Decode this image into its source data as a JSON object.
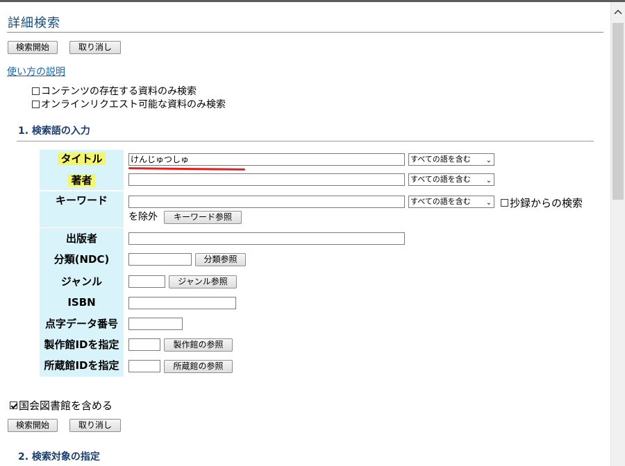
{
  "page_title": "詳細検索",
  "buttons": {
    "search": "検索開始",
    "cancel": "取り消し"
  },
  "help_link": "使い方の説明",
  "options": {
    "content_only": "コンテンツの存在する資料のみ検索",
    "online_request_only": "オンラインリクエスト可能な資料のみ検索"
  },
  "section1": "1. 検索語の入力",
  "section2": "2. 検索対象の指定",
  "fields": {
    "title": {
      "label": "タイトル",
      "value": "けんじゅつしゅ",
      "match": "すべての語を含む"
    },
    "author": {
      "label": "著者",
      "value": "",
      "match": "すべての語を含む"
    },
    "keyword": {
      "label": "キーワード",
      "value": "",
      "match": "すべての語を含む",
      "exclude_abstract": "抄録からの検索",
      "exclude_suffix": "を除外",
      "ref_button": "キーワード参照"
    },
    "publisher": {
      "label": "出版者",
      "value": ""
    },
    "ndc": {
      "label": "分類(NDC)",
      "value": "",
      "ref_button": "分類参照"
    },
    "genre": {
      "label": "ジャンル",
      "value": "",
      "ref_button": "ジャンル参照"
    },
    "isbn": {
      "label": "ISBN",
      "value": ""
    },
    "braille_no": {
      "label": "点字データ番号",
      "value": ""
    },
    "producer_id": {
      "label": "製作館IDを指定",
      "value": "",
      "ref_button": "製作館の参照"
    },
    "holder_id": {
      "label": "所蔵館IDを指定",
      "value": "",
      "ref_button": "所蔵館の参照"
    }
  },
  "include_ndl": {
    "label": "国会図書館を含める",
    "checked": true
  },
  "icons": {
    "scroll_up": "chevron-up-icon",
    "dropdown": "chevron-down-icon"
  },
  "colors": {
    "label_bg": "#d9f3fb",
    "highlight": "#f3f56a",
    "title_color": "#1a4d7a",
    "link": "#1565b0",
    "annotation": "#e02020"
  }
}
